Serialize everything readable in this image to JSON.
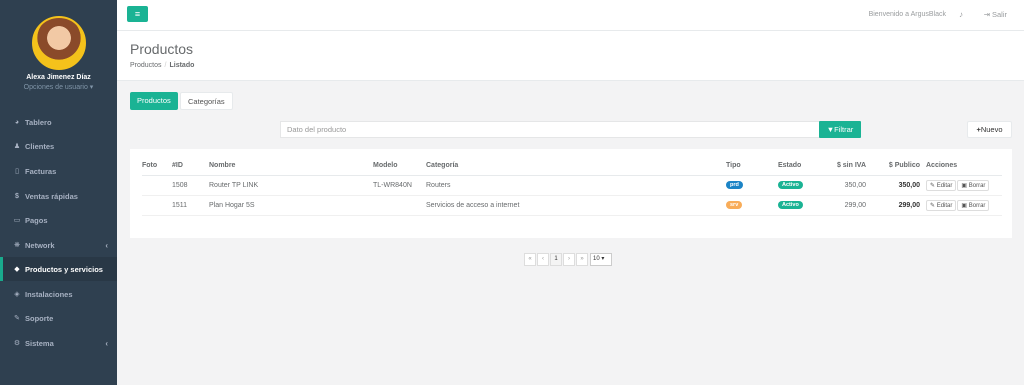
{
  "colors": {
    "sidebar": "#2f4050",
    "accent": "#1ab394",
    "prd": "#1c84c6",
    "srv": "#f8ac59",
    "active": "#1ab394"
  },
  "user": {
    "name": "Alexa Jimenez Díaz",
    "options": "Opciones de usuario ▾"
  },
  "topbar": {
    "welcome": "Bienvenido a ArgusBlack",
    "logout": "Salir"
  },
  "page": {
    "title": "Productos",
    "crumb_root": "Productos",
    "crumb_current": "Listado"
  },
  "tabs": [
    {
      "label": "Productos"
    },
    {
      "label": "Categorías"
    }
  ],
  "search": {
    "placeholder": "Dato del producto",
    "filter_label": "Filtrar",
    "new_label": "Nuevo"
  },
  "nav": [
    {
      "label": "Tablero",
      "icon": "tachometer-icon"
    },
    {
      "label": "Clientes",
      "icon": "users-icon"
    },
    {
      "label": "Facturas",
      "icon": "file-icon"
    },
    {
      "label": "Ventas rápidas",
      "icon": "dollar-icon"
    },
    {
      "label": "Pagos",
      "icon": "money-icon"
    },
    {
      "label": "Network",
      "icon": "network-icon"
    },
    {
      "label": "Productos y servicios",
      "icon": "tags-icon"
    },
    {
      "label": "Instalaciones",
      "icon": "plug-icon"
    },
    {
      "label": "Soporte",
      "icon": "wrench-icon"
    },
    {
      "label": "Sistema",
      "icon": "cogs-icon"
    }
  ],
  "table": {
    "headers": [
      "Foto",
      "#ID",
      "Nombre",
      "Modelo",
      "Categoría",
      "Tipo",
      "Estado",
      "$ sin IVA",
      "$ Publico",
      "Acciones"
    ],
    "rows": [
      {
        "id": "1508",
        "nombre": "Router TP LINK",
        "modelo": "TL-WR840N",
        "categoria": "Routers",
        "tipo": "prd",
        "estado": "Activo",
        "sin_iva": "350,00",
        "publico": "350,00"
      },
      {
        "id": "1511",
        "nombre": "Plan Hogar 5S",
        "modelo": "",
        "categoria": "Servicios de acceso a internet",
        "tipo": "srv",
        "estado": "Activo",
        "sin_iva": "299,00",
        "publico": "299,00"
      }
    ],
    "edit_label": "Editar",
    "delete_label": "Borrar"
  },
  "pagination": {
    "first": "«",
    "prev": "‹",
    "current": "1",
    "next": "›",
    "last": "»",
    "page_size": "10 ▾"
  }
}
